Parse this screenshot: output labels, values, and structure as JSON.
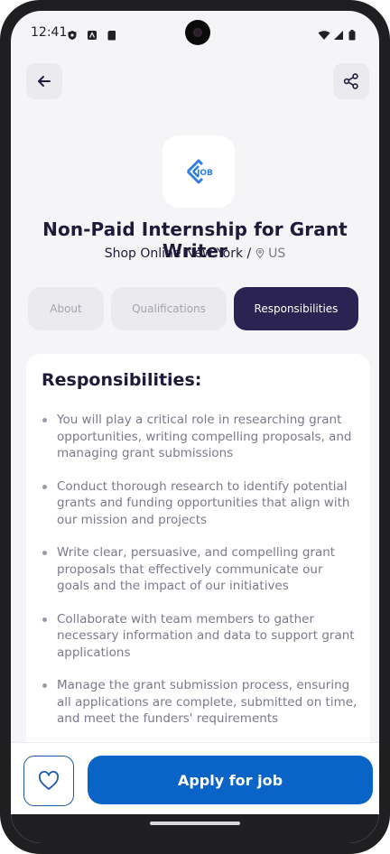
{
  "status_bar": {
    "time": "12:41"
  },
  "header": {
    "back_icon": "arrow-left-icon",
    "share_icon": "share-icon"
  },
  "job": {
    "logo_text": "JOB",
    "title": "Non-Paid Internship for Grant Writer",
    "company": "Shop Online New York /",
    "location": "US"
  },
  "tabs": [
    {
      "label": "About",
      "active": false
    },
    {
      "label": "Qualifications",
      "active": false
    },
    {
      "label": "Responsibilities",
      "active": true
    }
  ],
  "section": {
    "title": "Responsibilities:",
    "items": [
      "You will play a critical role in researching grant opportunities, writing compelling proposals, and managing grant submissions",
      "Conduct thorough research to identify potential grants and funding opportunities that align with our mission and projects",
      "Write clear, persuasive, and compelling grant proposals that effectively communicate our goals and the impact of our initiatives",
      "Collaborate with team members to gather necessary information and data to support grant applications",
      "Manage the grant submission process, ensuring all applications are complete, submitted on time, and meet the funders' requirements"
    ]
  },
  "actions": {
    "favorite_icon": "heart-icon",
    "apply_label": "Apply for job"
  },
  "colors": {
    "accent_primary": "#0a64c8",
    "tab_active": "#2b2352",
    "text_dark": "#1e1b3a"
  }
}
